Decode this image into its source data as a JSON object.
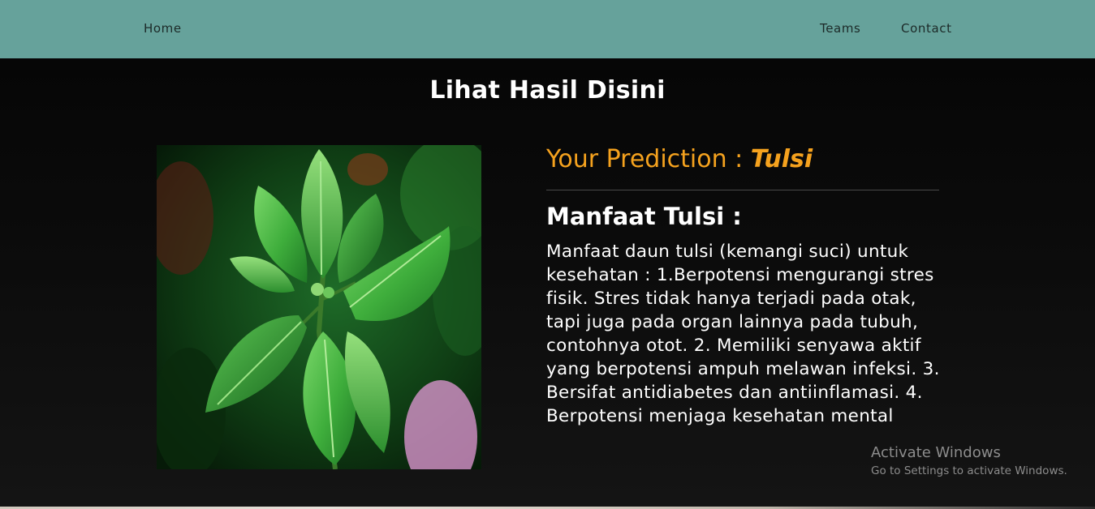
{
  "nav": {
    "home": "Home",
    "teams": "Teams",
    "contact": "Contact"
  },
  "page": {
    "title": "Lihat Hasil Disini"
  },
  "result": {
    "prediction_label": "Your Prediction : ",
    "prediction_value": "Tulsi",
    "benefit_heading": "Manfaat Tulsi :",
    "benefit_text": "Manfaat daun tulsi (kemangi suci) untuk kesehatan : 1.Berpotensi mengurangi stres fisik. Stres tidak hanya terjadi pada otak, tapi juga pada organ lainnya pada tubuh, contohnya otot. 2. Memiliki senyawa aktif yang berpotensi ampuh melawan infeksi. 3. Bersifat antidiabetes dan antiinflamasi. 4. Berpotensi menjaga kesehatan mental"
  },
  "watermark": {
    "title": "Activate Windows",
    "subtitle": "Go to Settings to activate Windows."
  },
  "colors": {
    "navbar": "#66a29b",
    "accent": "#f5a21e",
    "background": "#0a0a0a"
  }
}
